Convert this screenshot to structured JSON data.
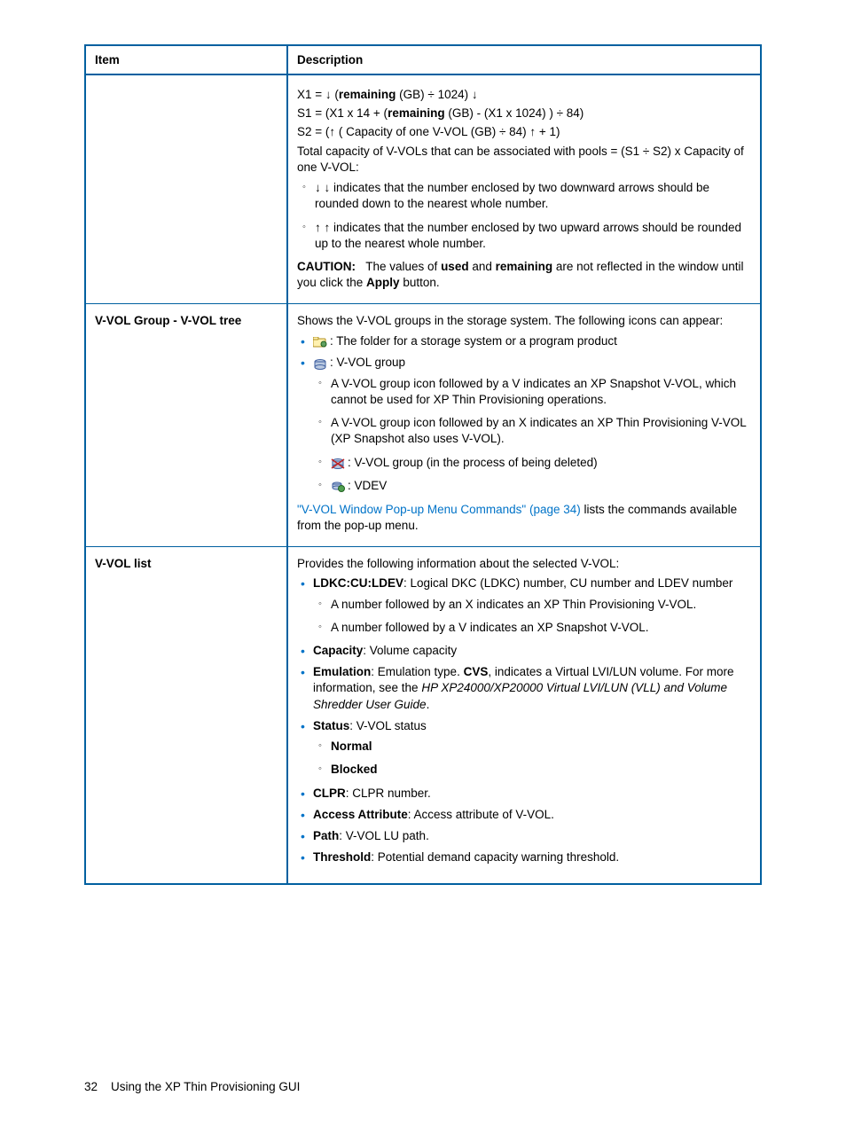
{
  "headers": {
    "item": "Item",
    "description": "Description"
  },
  "row1": {
    "item": "",
    "f1a": "X1 = ↓ (",
    "f1b": "remaining",
    "f1c": " (GB) ÷ 1024) ↓",
    "f2a": "S1 = (X1 x 14 + (",
    "f2b": "remaining",
    "f2c": " (GB) - (X1 x 1024) ) ÷ 84)",
    "f3": "S2 = (↑ ( Capacity of one V-VOL (GB) ÷ 84) ↑ + 1)",
    "f4": "Total capacity of V-VOLs that can be associated with pools = (S1 ÷ S2) x Capacity of one V-VOL:",
    "b1": "↓ ↓ indicates that the number enclosed by two downward arrows should be rounded down to the nearest whole number.",
    "b2": "↑ ↑ indicates that the number enclosed by two upward arrows should be rounded up to the nearest whole number.",
    "cautionLabel": "CAUTION:",
    "cautionA": "The values of ",
    "cautionUsed": "used",
    "cautionMid": " and ",
    "cautionRem": "remaining",
    "cautionB": " are not reflected in the window until you click the ",
    "cautionApply": "Apply",
    "cautionEnd": " button."
  },
  "row2": {
    "item": "V-VOL Group - V-VOL tree",
    "intro": "Shows the V-VOL groups in the storage system. The following icons can appear:",
    "b1": ": The folder for a storage system or a program product",
    "b2": ": V-VOL group",
    "b2s1": "A V-VOL group icon followed by a V indicates an XP Snapshot V-VOL, which cannot be used for XP Thin Provisioning operations.",
    "b2s2": "A V-VOL group icon followed by an X indicates an XP Thin Provisioning V-VOL (XP Snapshot also uses V-VOL).",
    "b2s3": ": V-VOL group (in the process of being deleted)",
    "b2s4": ": VDEV",
    "link": "\"V-VOL Window Pop-up Menu Commands\" (page 34)",
    "linkTail": " lists the commands available from the pop-up menu."
  },
  "row3": {
    "item": "V-VOL list",
    "intro": "Provides the following information about the selected V-VOL:",
    "b1label": "LDKC:CU:LDEV",
    "b1text": ": Logical DKC (LDKC) number, CU number and LDEV number",
    "b1s1": "A number followed by an X indicates an XP Thin Provisioning V-VOL.",
    "b1s2": "A number followed by a V indicates an XP Snapshot V-VOL.",
    "b2label": "Capacity",
    "b2text": ": Volume capacity",
    "b3label": "Emulation",
    "b3a": ": Emulation type. ",
    "b3cvs": "CVS",
    "b3b": ", indicates a Virtual LVI/LUN volume. For more information, see the ",
    "b3italic": "HP XP24000/XP20000 Virtual LVI/LUN (VLL) and Volume Shredder User Guide",
    "b3c": ".",
    "b4label": "Status",
    "b4text": ": V-VOL status",
    "b4s1": "Normal",
    "b4s2": "Blocked",
    "b5label": "CLPR",
    "b5text": ": CLPR number.",
    "b6label": "Access Attribute",
    "b6text": ": Access attribute of V-VOL.",
    "b7label": "Path",
    "b7text": ": V-VOL LU path.",
    "b8label": "Threshold",
    "b8text": ": Potential demand capacity warning threshold."
  },
  "footer": {
    "pageNum": "32",
    "title": "Using the XP Thin Provisioning GUI"
  }
}
